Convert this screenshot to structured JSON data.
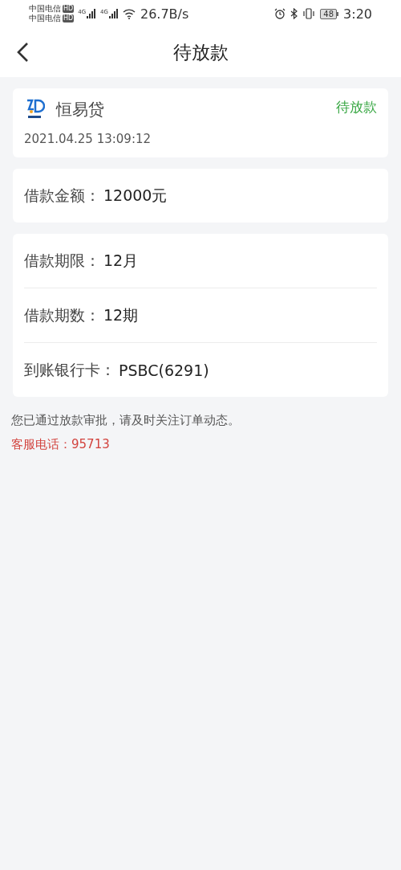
{
  "status_bar": {
    "carriers": [
      {
        "name": "中国电信",
        "badge": "HD",
        "network": "4G"
      },
      {
        "name": "中国电信",
        "badge": "HD",
        "network": "4G"
      }
    ],
    "speed": "26.7B/s",
    "battery": "48",
    "time": "3:20"
  },
  "header": {
    "title": "待放款"
  },
  "order": {
    "lender": "恒易贷",
    "status": "待放款",
    "datetime": "2021.04.25 13:09:12"
  },
  "amount": {
    "label": "借款金额：",
    "value": "12000元"
  },
  "details": [
    {
      "label": "借款期限：",
      "value": "12月"
    },
    {
      "label": "借款期数：",
      "value": "12期"
    },
    {
      "label": "到账银行卡：",
      "value": "PSBC(6291)"
    }
  ],
  "note": "您已通过放款审批，请及时关注订单动态。",
  "hotline": {
    "label": "客服电话：",
    "value": "95713"
  }
}
